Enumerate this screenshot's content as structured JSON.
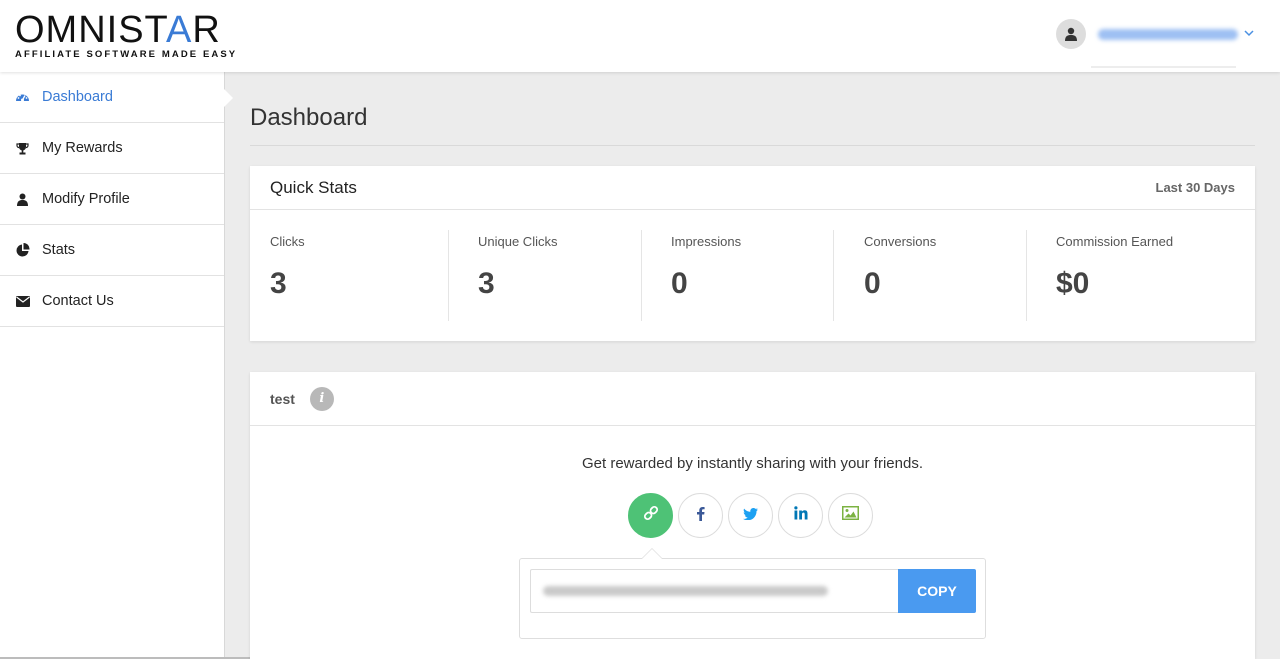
{
  "brand": {
    "logo_main_a": "OMNIST",
    "logo_main_accent": "A",
    "logo_main_b": "R",
    "tagline": "AFFILIATE SOFTWARE MADE EASY"
  },
  "header": {
    "user_icon": "user-icon",
    "dropdown_icon": "chevron-down-icon"
  },
  "sidebar": {
    "items": [
      {
        "label": "Dashboard",
        "icon": "dashboard-icon",
        "active": true
      },
      {
        "label": "My Rewards",
        "icon": "trophy-icon",
        "active": false
      },
      {
        "label": "Modify Profile",
        "icon": "user-icon",
        "active": false
      },
      {
        "label": "Stats",
        "icon": "pie-chart-icon",
        "active": false
      },
      {
        "label": "Contact Us",
        "icon": "envelope-icon",
        "active": false
      }
    ]
  },
  "page": {
    "title": "Dashboard"
  },
  "quick_stats": {
    "title": "Quick Stats",
    "range": "Last 30 Days",
    "stats": [
      {
        "label": "Clicks",
        "value": "3"
      },
      {
        "label": "Unique Clicks",
        "value": "3"
      },
      {
        "label": "Impressions",
        "value": "0"
      },
      {
        "label": "Conversions",
        "value": "0"
      },
      {
        "label": "Commission Earned",
        "value": "$0"
      }
    ]
  },
  "share": {
    "name": "test",
    "info_icon": "info-icon",
    "tagline": "Get rewarded by instantly sharing with your friends.",
    "buttons": [
      {
        "icon": "link-icon",
        "active": true
      },
      {
        "icon": "facebook-icon",
        "active": false
      },
      {
        "icon": "twitter-icon",
        "active": false
      },
      {
        "icon": "linkedin-icon",
        "active": false
      },
      {
        "icon": "image-icon",
        "active": false
      }
    ],
    "copy_label": "COPY"
  },
  "colors": {
    "accent": "#3a7bd5",
    "copy_button": "#4a9af0",
    "active_share": "#4ec276",
    "facebook": "#3b5998",
    "twitter": "#1da1f2",
    "linkedin": "#0077b5",
    "image": "#7cb342"
  }
}
